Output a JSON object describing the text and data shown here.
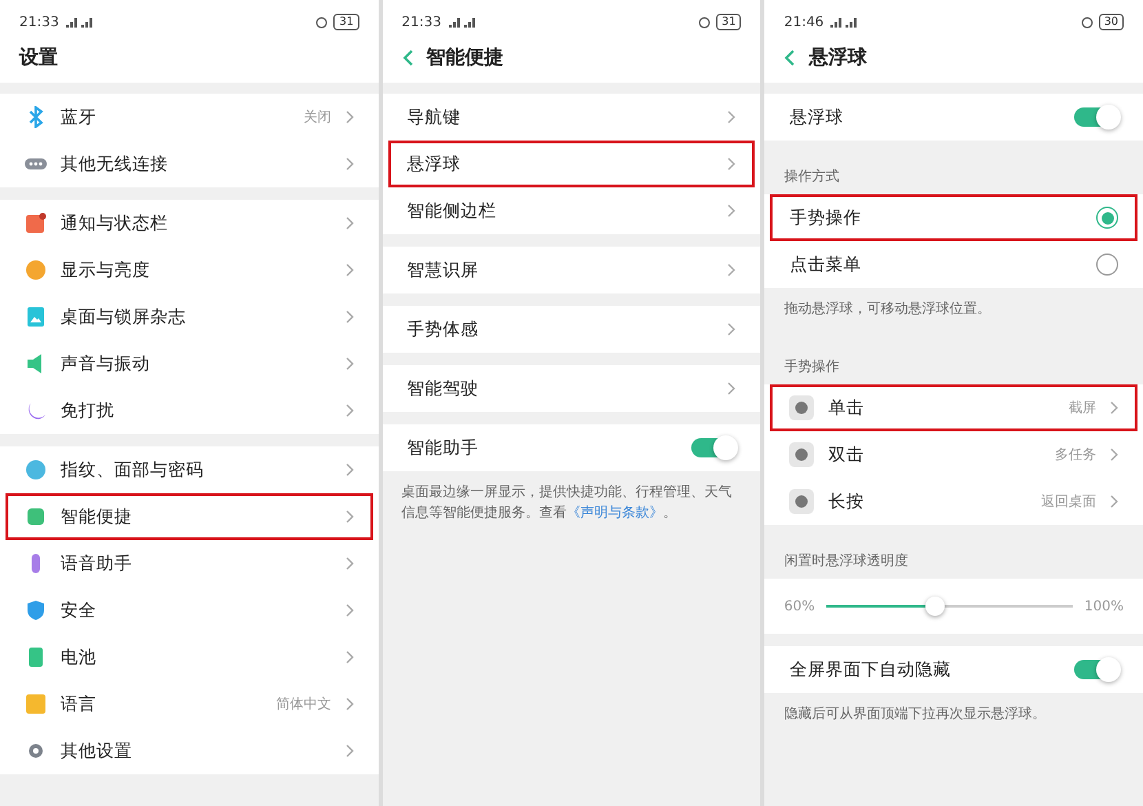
{
  "screens": [
    {
      "status": {
        "time": "21:33",
        "battery": "31"
      },
      "title": "设置",
      "back": false,
      "groups": [
        [
          {
            "label": "蓝牙",
            "value": "关闭",
            "highlighted": false
          },
          {
            "label": "其他无线连接",
            "highlighted": false
          }
        ],
        [
          {
            "label": "通知与状态栏",
            "highlighted": false
          },
          {
            "label": "显示与亮度",
            "highlighted": false
          },
          {
            "label": "桌面与锁屏杂志",
            "highlighted": false
          },
          {
            "label": "声音与振动",
            "highlighted": false
          },
          {
            "label": "免打扰",
            "highlighted": false
          }
        ],
        [
          {
            "label": "指纹、面部与密码",
            "highlighted": false
          },
          {
            "label": "智能便捷",
            "highlighted": true
          },
          {
            "label": "语音助手",
            "highlighted": false
          },
          {
            "label": "安全",
            "highlighted": false
          },
          {
            "label": "电池",
            "highlighted": false
          },
          {
            "label": "语言",
            "value": "简体中文",
            "highlighted": false
          },
          {
            "label": "其他设置",
            "highlighted": false
          }
        ]
      ]
    },
    {
      "status": {
        "time": "21:33",
        "battery": "31"
      },
      "title": "智能便捷",
      "back": true,
      "groups": [
        [
          {
            "kind": "link",
            "label": "导航键",
            "highlighted": false
          },
          {
            "kind": "link",
            "label": "悬浮球",
            "highlighted": true
          },
          {
            "kind": "link",
            "label": "智能侧边栏",
            "highlighted": false
          }
        ],
        [
          {
            "kind": "link",
            "label": "智慧识屏",
            "highlighted": false
          }
        ],
        [
          {
            "kind": "link",
            "label": "手势体感",
            "highlighted": false
          }
        ],
        [
          {
            "kind": "link",
            "label": "智能驾驶",
            "highlighted": false
          }
        ],
        [
          {
            "kind": "toggle",
            "label": "智能助手",
            "on": true,
            "highlighted": false
          },
          {
            "kind": "note",
            "text": "桌面最边缘一屏显示，提供快捷功能、行程管理、天气信息等智能便捷服务。查看",
            "link": "《声明与条款》",
            "after": "。"
          }
        ]
      ]
    },
    {
      "status": {
        "time": "21:46",
        "battery": "30"
      },
      "title": "悬浮球",
      "back": true,
      "groups": [
        [
          {
            "kind": "toggle",
            "label": "悬浮球",
            "on": true,
            "highlighted": false
          }
        ],
        [
          {
            "kind": "header",
            "text": "操作方式"
          },
          {
            "kind": "radio",
            "label": "手势操作",
            "selected": true,
            "highlighted": true
          },
          {
            "kind": "radio",
            "label": "点击菜单",
            "selected": false,
            "highlighted": false
          },
          {
            "kind": "note",
            "text": "拖动悬浮球，可移动悬浮球位置。"
          }
        ],
        [
          {
            "kind": "header",
            "text": "手势操作"
          },
          {
            "kind": "gesture",
            "label": "单击",
            "value": "截屏",
            "highlighted": true
          },
          {
            "kind": "gesture",
            "label": "双击",
            "value": "多任务",
            "highlighted": false
          },
          {
            "kind": "gesture",
            "label": "长按",
            "value": "返回桌面",
            "highlighted": false
          }
        ],
        [
          {
            "kind": "header",
            "text": "闲置时悬浮球透明度"
          },
          {
            "kind": "slider",
            "min": "60%",
            "max": "100%",
            "level": 0.44
          }
        ],
        [
          {
            "kind": "toggle",
            "label": "全屏界面下自动隐藏",
            "on": true,
            "highlighted": false
          },
          {
            "kind": "note",
            "text": "隐藏后可从界面顶端下拉再次显示悬浮球。"
          }
        ]
      ]
    }
  ]
}
